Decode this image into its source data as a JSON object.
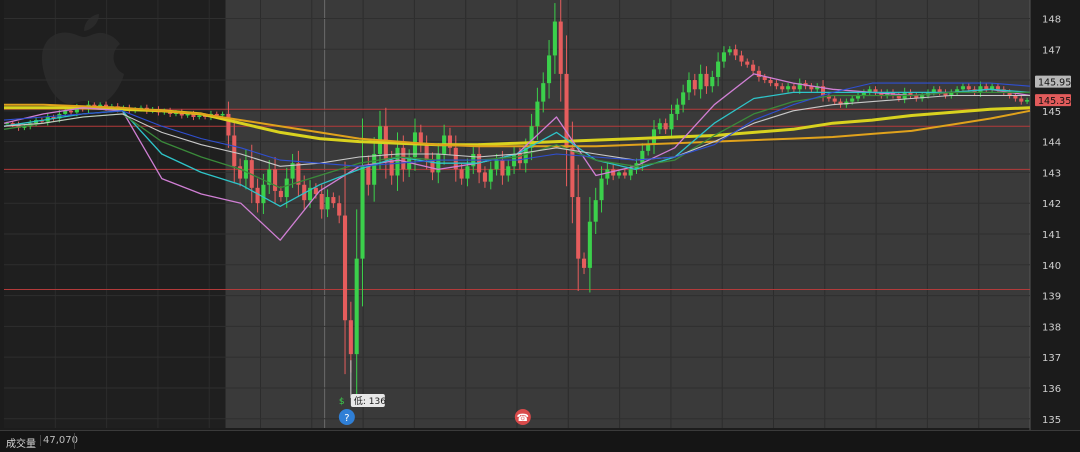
{
  "chart_data": {
    "type": "candlestick",
    "ylim": [
      134.7,
      148.6
    ],
    "y_ticks": [
      148,
      147,
      146,
      145,
      144,
      143,
      142,
      141,
      140,
      139,
      138,
      137,
      136,
      135
    ],
    "price_tags": [
      {
        "value": 145.95,
        "label": "145.95",
        "color": "#b8b8b8"
      },
      {
        "value": 145.35,
        "label": "145.35",
        "color": "#e15b5b"
      }
    ],
    "horizontal_levels": [
      145.05,
      144.5,
      143.1,
      139.2
    ],
    "low_marker": {
      "label": "低: 136",
      "value": 136,
      "small_label": "$"
    },
    "event_icons": [
      {
        "name": "earnings",
        "glyph": "?",
        "color": "#2f7fd6"
      },
      {
        "name": "conference-call",
        "glyph": "☎",
        "color": "#d94b4b"
      }
    ],
    "sessions": [
      {
        "name": "premarket",
        "bars": 38
      },
      {
        "name": "regular",
        "bars": 156
      }
    ],
    "candles_close": [
      144.6,
      144.55,
      144.45,
      144.5,
      144.6,
      144.7,
      144.65,
      144.8,
      144.75,
      144.9,
      145.0,
      144.95,
      145.1,
      145.05,
      145.2,
      145.15,
      145.2,
      145.1,
      145.15,
      145.05,
      145.1,
      145.0,
      145.05,
      145.1,
      145.0,
      145.05,
      144.95,
      145.0,
      144.9,
      144.95,
      144.85,
      144.9,
      144.8,
      144.85,
      144.8,
      144.9,
      144.85,
      144.9,
      144.2,
      143.2,
      142.8,
      143.4,
      142.5,
      142.0,
      142.6,
      143.1,
      142.4,
      142.2,
      142.8,
      143.3,
      142.6,
      142.1,
      142.5,
      142.3,
      141.8,
      142.2,
      142.0,
      141.6,
      138.2,
      137.1,
      140.2,
      143.2,
      142.6,
      143.6,
      144.5,
      143.4,
      142.9,
      143.8,
      143.1,
      143.5,
      144.3,
      143.9,
      143.4,
      143.0,
      143.6,
      144.2,
      143.8,
      143.1,
      142.8,
      143.2,
      143.6,
      143.0,
      142.7,
      143.1,
      143.4,
      142.9,
      143.2,
      143.6,
      143.3,
      143.8,
      144.5,
      145.3,
      145.9,
      146.8,
      147.9,
      146.2,
      143.8,
      142.2,
      140.2,
      139.9,
      141.4,
      142.1,
      142.8,
      143.1,
      142.9,
      143.0,
      142.9,
      143.1,
      143.3,
      143.7,
      143.9,
      144.4,
      144.6,
      144.4,
      144.9,
      145.2,
      145.6,
      146.0,
      145.7,
      146.2,
      145.8,
      146.1,
      146.6,
      146.9,
      147.0,
      146.8,
      146.6,
      146.5,
      146.3,
      146.1,
      146.0,
      145.9,
      145.8,
      145.7,
      145.8,
      145.7,
      145.9,
      145.8,
      145.7,
      145.8,
      145.5,
      145.4,
      145.3,
      145.2,
      145.3,
      145.4,
      145.5,
      145.6,
      145.7,
      145.6,
      145.5,
      145.6,
      145.5,
      145.4,
      145.6,
      145.5,
      145.4,
      145.5,
      145.6,
      145.7,
      145.6,
      145.5,
      145.6,
      145.7,
      145.8,
      145.7,
      145.6,
      145.8,
      145.7,
      145.8,
      145.7,
      145.6,
      145.5,
      145.4,
      145.3,
      145.35
    ],
    "moving_averages": [
      {
        "color": "#d9d21f",
        "width": 3,
        "values": [
          145.1,
          145.1,
          145.1,
          145.05,
          145.0,
          144.9,
          144.6,
          144.3,
          144.1,
          144.0,
          143.95,
          143.9,
          143.9,
          143.95,
          144.0,
          144.05,
          144.1,
          144.15,
          144.2,
          144.3,
          144.4,
          144.6,
          144.7,
          144.85,
          144.95,
          145.05,
          145.1
        ]
      },
      {
        "color": "#e0a21c",
        "width": 2,
        "values": [
          145.2,
          145.2,
          145.15,
          145.1,
          145.0,
          144.9,
          144.7,
          144.5,
          144.3,
          144.1,
          144.0,
          143.9,
          143.85,
          143.85,
          143.85,
          143.85,
          143.9,
          143.95,
          144.0,
          144.05,
          144.1,
          144.15,
          144.25,
          144.35,
          144.55,
          144.75,
          145.0
        ]
      },
      {
        "color": "#d07fd4",
        "width": 1.3,
        "values": [
          144.6,
          144.9,
          145.1,
          145.0,
          142.8,
          142.3,
          142.0,
          140.8,
          142.4,
          143.2,
          143.4,
          143.1,
          143.3,
          143.6,
          144.8,
          142.9,
          143.2,
          143.8,
          145.2,
          146.2,
          145.9,
          145.7,
          145.6,
          145.5,
          145.6,
          145.7,
          145.5
        ]
      },
      {
        "color": "#2ec4c9",
        "width": 1.3,
        "values": [
          144.5,
          144.7,
          144.9,
          145.0,
          143.6,
          143.0,
          142.6,
          141.9,
          142.6,
          143.1,
          143.5,
          143.3,
          143.3,
          143.6,
          144.3,
          143.4,
          143.1,
          143.5,
          144.6,
          145.4,
          145.6,
          145.6,
          145.6,
          145.6,
          145.6,
          145.7,
          145.6
        ]
      },
      {
        "color": "#3a8a3a",
        "width": 1.3,
        "values": [
          144.4,
          144.6,
          144.8,
          144.9,
          144.0,
          143.5,
          143.1,
          142.5,
          142.9,
          143.3,
          143.5,
          143.4,
          143.4,
          143.5,
          143.9,
          143.4,
          143.2,
          143.4,
          144.2,
          144.9,
          145.3,
          145.5,
          145.5,
          145.5,
          145.6,
          145.6,
          145.6
        ]
      },
      {
        "color": "#c9c9c9",
        "width": 1.1,
        "values": [
          144.5,
          144.6,
          144.8,
          144.9,
          144.3,
          143.9,
          143.6,
          143.2,
          143.3,
          143.5,
          143.6,
          143.6,
          143.5,
          143.6,
          143.8,
          143.6,
          143.4,
          143.5,
          144.0,
          144.6,
          145.0,
          145.2,
          145.3,
          145.4,
          145.5,
          145.5,
          145.5
        ]
      },
      {
        "color": "#2f4fd1",
        "width": 1.1,
        "values": [
          144.7,
          144.8,
          144.9,
          145.0,
          144.5,
          144.1,
          143.8,
          143.4,
          143.3,
          143.2,
          143.3,
          143.4,
          143.4,
          143.4,
          143.6,
          143.5,
          143.4,
          143.5,
          143.9,
          144.7,
          145.2,
          145.6,
          145.9,
          145.9,
          145.9,
          145.9,
          145.8
        ]
      }
    ]
  },
  "volume": {
    "label": "成交量",
    "value": "47,070"
  }
}
